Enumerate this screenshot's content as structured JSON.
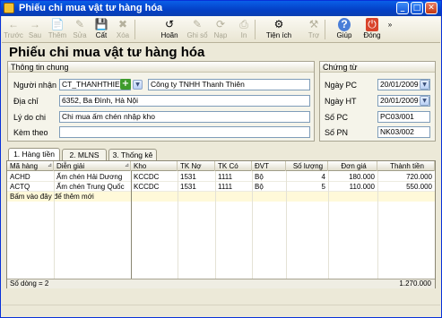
{
  "window": {
    "title": "Phiếu chi mua vật tư hàng hóa",
    "min": "_",
    "max": "□",
    "close": "✕"
  },
  "toolbar": [
    {
      "label": "Trước",
      "icon": "arrow-left-icon",
      "glyph": "←",
      "enabled": false
    },
    {
      "label": "Sau",
      "icon": "arrow-right-icon",
      "glyph": "→",
      "enabled": false
    },
    {
      "label": "Thêm",
      "icon": "add-doc-icon",
      "glyph": "📄",
      "enabled": false
    },
    {
      "label": "Sửa",
      "icon": "edit-icon",
      "glyph": "✎",
      "enabled": false
    },
    {
      "label": "Cất",
      "icon": "save-icon",
      "glyph": "💾",
      "enabled": true
    },
    {
      "label": "Xóa",
      "icon": "delete-icon",
      "glyph": "✖",
      "enabled": false
    },
    {
      "label": "Hoãn",
      "icon": "undo-icon",
      "glyph": "↺",
      "enabled": true
    },
    {
      "label": "Ghi sổ",
      "icon": "post-icon",
      "glyph": "✎",
      "enabled": false
    },
    {
      "label": "Nạp",
      "icon": "reload-icon",
      "glyph": "⟳",
      "enabled": false
    },
    {
      "label": "In",
      "icon": "print-icon",
      "glyph": "⎙",
      "enabled": false
    },
    {
      "label": "Tiện ích",
      "icon": "utilities-icon",
      "glyph": "⚙",
      "enabled": true
    },
    {
      "label": "Trợ",
      "icon": "tools-icon",
      "glyph": "⚒",
      "enabled": false
    },
    {
      "label": "Giúp",
      "icon": "help-icon",
      "glyph": "?",
      "enabled": true
    },
    {
      "label": "Đóng",
      "icon": "close-icon",
      "glyph": "⏻",
      "enabled": true
    }
  ],
  "heading": "Phiếu chi mua vật tư hàng hóa",
  "general": {
    "title": "Thông tin chung",
    "recipient_label": "Người nhận",
    "recipient_code": "CT_THANHTHIEN",
    "recipient_name": "Công ty TNHH Thanh Thiên",
    "address_label": "Địa chỉ",
    "address": "6352, Ba Đình, Hà Nội",
    "reason_label": "Lý do chi",
    "reason": "Chi mua ấm chén nhập kho",
    "attach_label": "Kèm theo",
    "attach": ""
  },
  "voucher": {
    "title": "Chứng từ",
    "date_pc_label": "Ngày PC",
    "date_pc": "20/01/2009",
    "date_ht_label": "Ngày HT",
    "date_ht": "20/01/2009",
    "so_pc_label": "Số PC",
    "so_pc": "PC03/001",
    "so_pn_label": "Số PN",
    "so_pn": "NK03/002"
  },
  "tabs": [
    "1. Hàng tiền",
    "2. MLNS",
    "3. Thống kê"
  ],
  "grid": {
    "columns": [
      "Mã hàng",
      "Diễn giải",
      "Kho",
      "TK Nợ",
      "TK Có",
      "ĐVT",
      "Số lượng",
      "Đơn giá",
      "Thành tiền"
    ],
    "rows": [
      [
        "ACHD",
        "Ấm chén Hải Dương",
        "KCCDC",
        "1531",
        "1111",
        "Bộ",
        "4",
        "180.000",
        "720.000"
      ],
      [
        "ACTQ",
        "Ấm chén Trung Quốc",
        "KCCDC",
        "1531",
        "1111",
        "Bộ",
        "5",
        "110.000",
        "550.000"
      ]
    ],
    "new_row_hint": "Bấm vào đây để thêm mới",
    "row_count": "Số dòng = 2",
    "total": "1.270.000"
  }
}
